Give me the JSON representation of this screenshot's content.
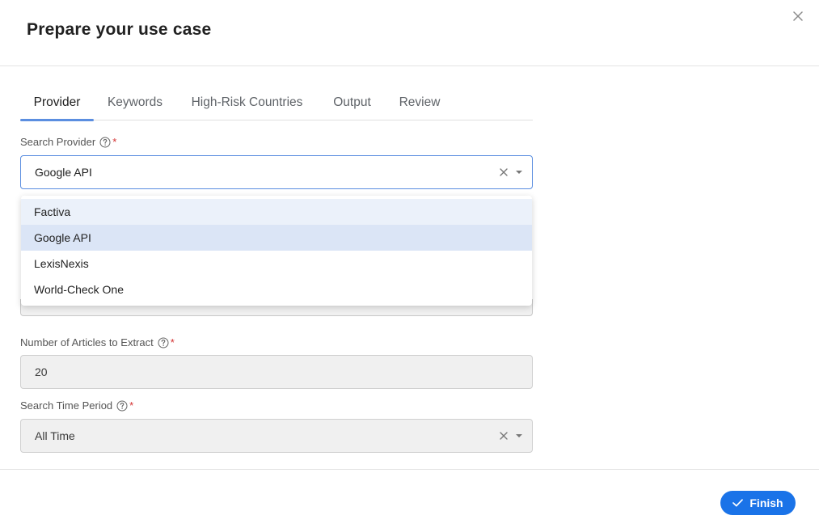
{
  "dialog": {
    "title": "Prepare your use case"
  },
  "tabs": [
    {
      "label": "Provider",
      "active": true
    },
    {
      "label": "Keywords"
    },
    {
      "label": "High-Risk Countries"
    },
    {
      "label": "Output"
    },
    {
      "label": "Review"
    }
  ],
  "form": {
    "search_provider": {
      "label": "Search Provider",
      "required_mark": "*",
      "value": "Google API",
      "options": [
        "Factiva",
        "Google API",
        "LexisNexis",
        "World-Check One"
      ]
    },
    "num_articles": {
      "label": "Number of Articles to Extract",
      "required_mark": "*",
      "value": "20"
    },
    "time_period": {
      "label": "Search Time Period",
      "required_mark": "*",
      "value": "All Time"
    }
  },
  "footer": {
    "finish_label": "Finish"
  },
  "colors": {
    "accent": "#1a73e8",
    "tab_indicator": "#5b8ee0",
    "required": "#d32f2f",
    "option_selected": "#dbe5f6",
    "option_hover": "#ebf1fa"
  },
  "icons": {
    "close": "close-icon",
    "help": "help-circle-icon",
    "clear": "clear-x-icon",
    "caret": "caret-down-icon",
    "check": "check-icon"
  }
}
